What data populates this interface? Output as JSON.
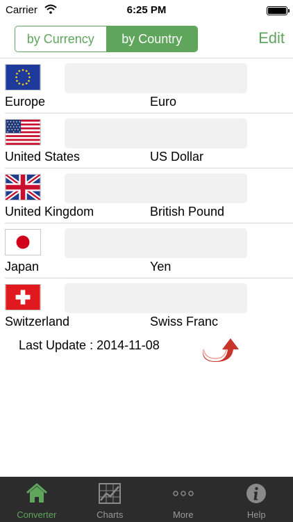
{
  "status_bar": {
    "carrier": "Carrier",
    "time": "6:25 PM"
  },
  "nav": {
    "segments": [
      {
        "label": "by Currency",
        "selected": false
      },
      {
        "label": "by Country",
        "selected": true
      }
    ],
    "edit_label": "Edit"
  },
  "rows": [
    {
      "flag": "eu-flag-icon",
      "country": "Europe",
      "currency": "Euro"
    },
    {
      "flag": "us-flag-icon",
      "country": "United States",
      "currency": "US Dollar"
    },
    {
      "flag": "uk-flag-icon",
      "country": "United Kingdom",
      "currency": "British Pound"
    },
    {
      "flag": "japan-flag-icon",
      "country": "Japan",
      "currency": "Yen"
    },
    {
      "flag": "swiss-flag-icon",
      "country": "Switzerland",
      "currency": "Swiss Franc"
    }
  ],
  "footer": {
    "last_update": "Last Update : 2014-11-08",
    "refresh_icon": "refresh-arrow-icon"
  },
  "tabs": [
    {
      "label": "Converter",
      "icon": "home-icon",
      "active": true
    },
    {
      "label": "Charts",
      "icon": "chart-icon",
      "active": false
    },
    {
      "label": "More",
      "icon": "more-dots-icon",
      "active": false
    },
    {
      "label": "Help",
      "icon": "info-icon",
      "active": false
    }
  ],
  "colors": {
    "accent": "#5fa55c",
    "tabbar": "#2c2c2c",
    "refresh": "#d33a2c"
  }
}
